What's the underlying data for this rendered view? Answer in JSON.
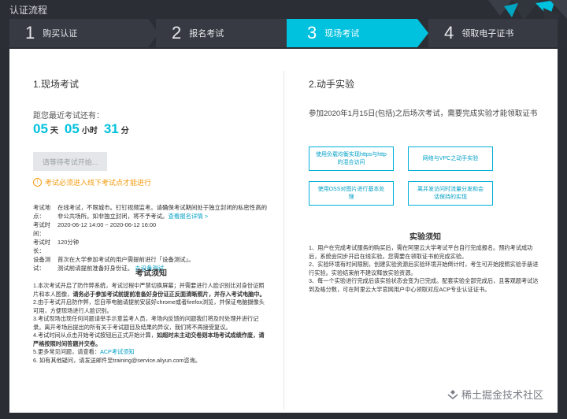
{
  "header": {
    "title": "认证流程"
  },
  "steps": [
    {
      "num": "1",
      "label": "购买认证",
      "active": false
    },
    {
      "num": "2",
      "label": "报名考试",
      "active": false
    },
    {
      "num": "3",
      "label": "现场考试",
      "active": true
    },
    {
      "num": "4",
      "label": "领取电子证书",
      "active": false
    }
  ],
  "left": {
    "title": "1.现场考试",
    "countdown_label": "距您最近考试还有：",
    "countdown": {
      "days": "05",
      "days_unit": "天",
      "hours": "05",
      "hours_unit": "小时",
      "minutes": "31",
      "minutes_unit": "分"
    },
    "wait_button": "请等待考试开始...",
    "warning": "考试必须进入线下考试点才能进行",
    "info": {
      "location_key": "考试地点：",
      "location_val": "在线考试，不限城市。钉钉视频监考。请确保考试期间处于独立封闭的私密性高的非公共场所。如非独立封闭，将不予考试。",
      "location_link": "查看报名详情 >",
      "time_key": "考试时间：",
      "time_val": "2020-06-12 14:00 ~ 2020-06-12 16:00",
      "duration_key": "考试时长：",
      "duration_val": "120分钟",
      "device_key": "设备测试：",
      "device_val1": "首次在大学参加考试的用户需提前进行「设备测试」。",
      "device_val2": "测试前请提前准备好身份证。",
      "device_link": "去设备测试"
    },
    "notice_title": "考试须知",
    "notice": {
      "p1a": "1.本次考试开启了防作弊系统，考试过程中严禁切换屏幕；并需要进行人脸识别比对身份证照片和本人图像，",
      "p1b": "请务必于参加考试前提前准备好身份证正反面清晰照片，并存入考试电脑中。",
      "p2": "2.由于考试开启防作弊，您自带电脑请提前安装好chrome或者firefox浏览，并保证电脑摄像头可用，方便现场进行人脸识别。",
      "p3": "3.考试现场出现任何问题请举手示意监考人员，考场内反馈的问题我们将及时处理并进行记录。离开考场后提出的所有关于考试题目及结果的异议，我们将不再接受复议。",
      "p4a": "4.考试时间从点击开始考试按钮后正式开始计算，",
      "p4b": "如超时未主动交卷则本场考试成绩作废，请严格按照时间答题并交卷。",
      "p5a": "5.更多常见问题，请查看：",
      "p5link": "ACP考试须知",
      "p6": "6. 如有其他疑问，请发送邮件至training@service.aliyun.com咨询。"
    }
  },
  "right": {
    "title": "2.动手实验",
    "desc": "参加2020年1月15日(包括)之后场次考试，需要完成实验才能领取证书",
    "labs": [
      "使用负载均衡实现https与http的混合访问",
      "网络与VPC之动手实验",
      "使用OSS对图片进行基本处理",
      "离并发访问时流量分发和会话保持的实现"
    ],
    "notice_title": "实验须知",
    "notice": {
      "p1": "1、用户在完成考试服务的购买后，需在阿里云大学考试平台自行完成报名。预约考试成功后，系统会同步开启在线实验。您需要在领取证书前完成实验。",
      "p2": "2、实验环境有时间限制，创建实验资源后实验环境开始倒计时，考生可开始按照实验手册进行实验。实验结束前不建议释放实验资源。",
      "p3": "3、每一个实验进行完成后该实验状态会变为已完成。配套实验全部完成后，且客观题考试达到及格分数，可在阿里云大学官网用户中心领取对应ACP专业认证证书。"
    }
  },
  "watermark": "稀土掘金技术社区",
  "colors": {
    "accent": "#00c1de",
    "warning": "#f39c12",
    "header_bg": "#2b2e34"
  }
}
